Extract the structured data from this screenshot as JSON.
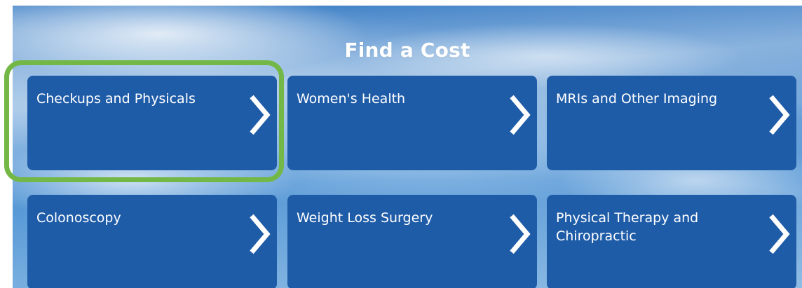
{
  "hero": {
    "title": "Find a Cost"
  },
  "tiles": [
    {
      "label": "Checkups and Physicals",
      "icon": "chevron-right-icon"
    },
    {
      "label": "Women's Health",
      "icon": "chevron-right-icon"
    },
    {
      "label": "MRIs and Other Imaging",
      "icon": "chevron-right-icon"
    },
    {
      "label": "Colonoscopy",
      "icon": "chevron-right-icon"
    },
    {
      "label": "Weight Loss Surgery",
      "icon": "chevron-right-icon"
    },
    {
      "label": "Physical Therapy and Chiropractic",
      "icon": "chevron-right-icon"
    }
  ],
  "colors": {
    "tile_background": "#1f5ca8",
    "highlight_border": "#73b846",
    "text": "#ffffff"
  }
}
